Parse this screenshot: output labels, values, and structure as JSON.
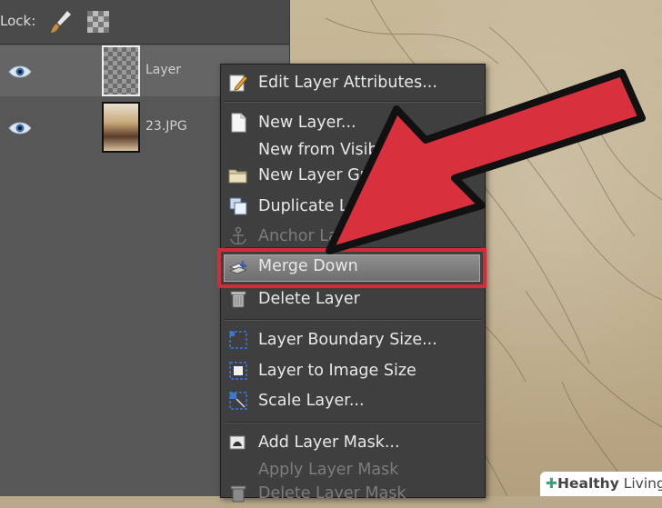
{
  "lockbar": {
    "label": "Lock:"
  },
  "layers": [
    {
      "name": "Layer",
      "thumb": "transparent-checker",
      "selected": true
    },
    {
      "name": "23.JPG",
      "thumb": "photo",
      "selected": false
    }
  ],
  "menu": {
    "items": [
      {
        "label": "Edit Layer Attributes...",
        "icon": "edit-attributes-icon",
        "enabled": true
      },
      {
        "label": "New Layer...",
        "icon": "new-layer-icon",
        "enabled": true
      },
      {
        "label": "New from Visible",
        "icon": "",
        "enabled": true
      },
      {
        "label": "New Layer Group",
        "icon": "folder-icon",
        "enabled": true
      },
      {
        "label": "Duplicate Layer",
        "icon": "duplicate-icon",
        "enabled": true
      },
      {
        "label": "Anchor Layer",
        "icon": "anchor-icon",
        "enabled": false
      },
      {
        "label": "Merge Down",
        "icon": "merge-down-icon",
        "enabled": true,
        "highlighted": true
      },
      {
        "label": "Delete Layer",
        "icon": "trash-icon",
        "enabled": true
      },
      {
        "label": "Layer Boundary Size...",
        "icon": "boundary-size-icon",
        "enabled": true
      },
      {
        "label": "Layer to Image Size",
        "icon": "layer-to-image-icon",
        "enabled": true
      },
      {
        "label": "Scale Layer...",
        "icon": "scale-layer-icon",
        "enabled": true
      },
      {
        "label": "Add Layer Mask...",
        "icon": "add-mask-icon",
        "enabled": true
      },
      {
        "label": "Apply Layer Mask",
        "icon": "",
        "enabled": false
      },
      {
        "label": "Delete Layer Mask",
        "icon": "delete-mask-icon",
        "enabled": false
      }
    ]
  },
  "watermark": {
    "plus": "✚",
    "brand_bold": "Healthy",
    "brand_light": " Living"
  },
  "colors": {
    "highlight_border": "#d42b38",
    "arrow_fill": "#d9303e",
    "menu_bg": "#3f3f3f"
  }
}
